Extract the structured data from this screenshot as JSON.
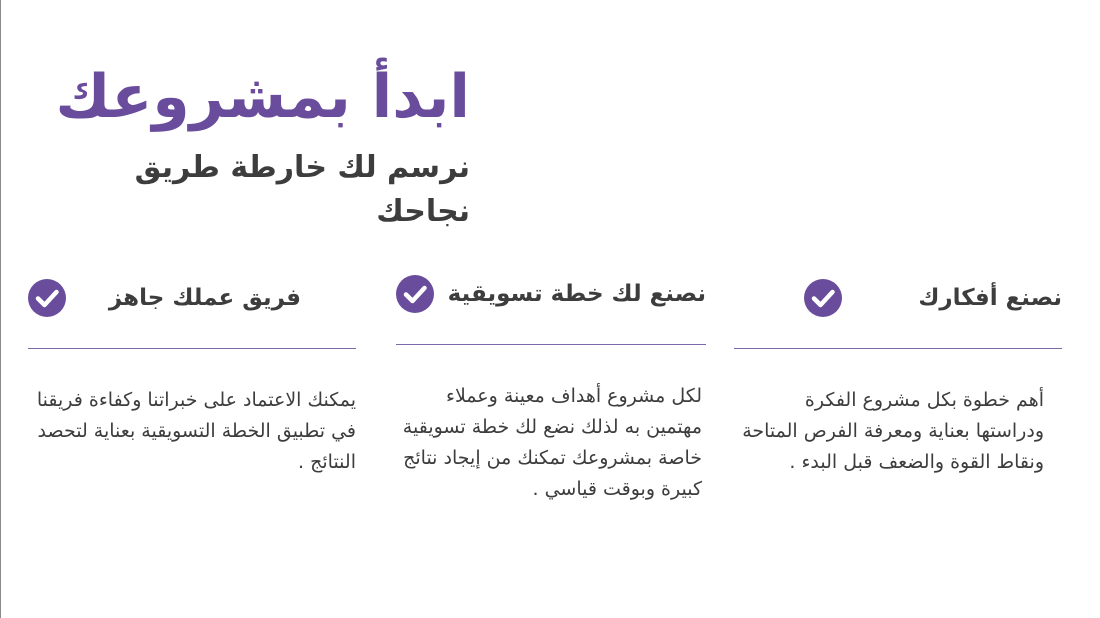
{
  "hero": {
    "title": "ابدأ بمشروعك",
    "subtitle": "نرسم لك خارطة طريق نجاحك"
  },
  "colors": {
    "accent": "#6a4c9c",
    "text": "#3d3d3d"
  },
  "features": [
    {
      "icon": "check-circle-icon",
      "title": "نصنع أفكارك",
      "body": "أهم خطوة بكل مشروع الفكرة ودراستها بعناية ومعرفة الفرص المتاحة ونقاط القوة والضعف قبل البدء ."
    },
    {
      "icon": "check-circle-icon",
      "title": "نصنع لك خطة تسويقية",
      "body": "لكل مشروع أهداف معينة وعملاء مهتمين به لذلك نضع لك خطة تسويقية خاصة بمشروعك تمكنك من إيجاد نتائج كبيرة وبوقت قياسي ."
    },
    {
      "icon": "check-circle-icon",
      "title": "فريق عملك جاهز",
      "body": "يمكنك الاعتماد على خبراتنا وكفاءة فريقنا في تطبيق الخطة التسويقية بعناية لتحصد النتائج ."
    }
  ]
}
